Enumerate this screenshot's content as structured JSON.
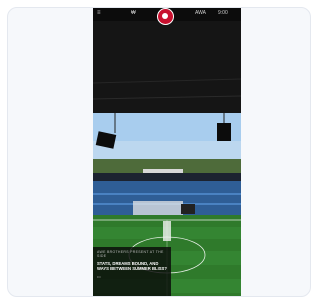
{
  "statusbar": {
    "left_icon": "menu-icon",
    "mid_text": "₩",
    "right_text": "AWA",
    "time": "9:00"
  },
  "logo": {
    "icon": "club-crest-icon",
    "color": "#c8102e"
  },
  "story": {
    "kicker": "AWE BROTHERS PRESENT AT THE SIDE",
    "headline": "Stats, Dreams Bound, And Ways Between Summer Bliss?",
    "more_label": "•••"
  },
  "colors": {
    "pitch": "#2f7a2b",
    "seats": "#3c77b7",
    "sky": "#9fc9ee"
  }
}
